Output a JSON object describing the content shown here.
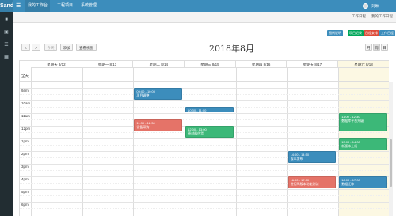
{
  "app": {
    "brand": "Sand",
    "menu_icon": "hamburger-icon"
  },
  "nav": {
    "items": [
      {
        "label": "我的工作台",
        "active": true
      },
      {
        "label": "工程项目"
      },
      {
        "label": "系统管理"
      }
    ]
  },
  "user": {
    "name": "刘琳"
  },
  "tabbar": {
    "tabs": [
      "工作日程",
      "我的工作日程"
    ],
    "close_icon": "close-icon"
  },
  "actions": {
    "items": [
      {
        "label": "图例说明",
        "color": "#3c8dbc"
      },
      {
        "label": "项目记录",
        "color": "#00a65a"
      },
      {
        "label": "日程安排",
        "color": "#dd4b39"
      },
      {
        "label": "工作日程",
        "color": "#3c8dbc"
      }
    ]
  },
  "toolbar": {
    "prev_label": "<",
    "next_label": ">",
    "today_label": "今天",
    "add_label": "添加",
    "list_label": "查看视图",
    "title": "2018年8月",
    "views": [
      "月",
      "周",
      "日"
    ]
  },
  "calendar": {
    "days": [
      "星期天 8/12",
      "星期一 8/13",
      "星期二 8/14",
      "星期三 8/15",
      "星期四 8/16",
      "星期五 8/17",
      "星期六 8/18"
    ],
    "allday_label": "全天",
    "hours": [
      "9am",
      "10am",
      "11am",
      "12pm",
      "1pm",
      "2pm",
      "3pm",
      "4pm",
      "5pm",
      "6pm"
    ],
    "today_col": 6,
    "first_hour": 9,
    "events": [
      {
        "day": 2,
        "start": 9.0,
        "end": 10.0,
        "time": "09:00 - 10:00",
        "title": "项目调整",
        "color": "#3c8dbc"
      },
      {
        "day": 3,
        "start": 10.5,
        "end": 11.0,
        "time": "10:30 - 11:00",
        "title": "工程本周例会",
        "color": "#3c8dbc"
      },
      {
        "day": 2,
        "start": 11.5,
        "end": 12.5,
        "time": "11:30 - 12:30",
        "title": "设备采购",
        "color": "#e57368"
      },
      {
        "day": 3,
        "start": 12.0,
        "end": 13.0,
        "time": "12:00 - 13:00",
        "title": "原材料供货",
        "color": "#3cb878"
      },
      {
        "day": 6,
        "start": 11.0,
        "end": 12.5,
        "time": "11:00 - 12:30",
        "title": "数据库平台升级",
        "color": "#3cb878"
      },
      {
        "day": 6,
        "start": 13.0,
        "end": 14.0,
        "time": "13:00 - 14:00",
        "title": "新版本上线",
        "color": "#3cb878"
      },
      {
        "day": 5,
        "start": 14.0,
        "end": 15.0,
        "time": "14:00 - 14:50",
        "title": "版本发布",
        "color": "#3c8dbc"
      },
      {
        "day": 5,
        "start": 16.0,
        "end": 17.0,
        "time": "16:00 - 17:00",
        "title": "进行降版本功能测试",
        "color": "#e57368"
      },
      {
        "day": 6,
        "start": 16.0,
        "end": 17.0,
        "time": "16:00 - 17:00",
        "title": "数据迁移",
        "color": "#3c8dbc"
      }
    ]
  }
}
